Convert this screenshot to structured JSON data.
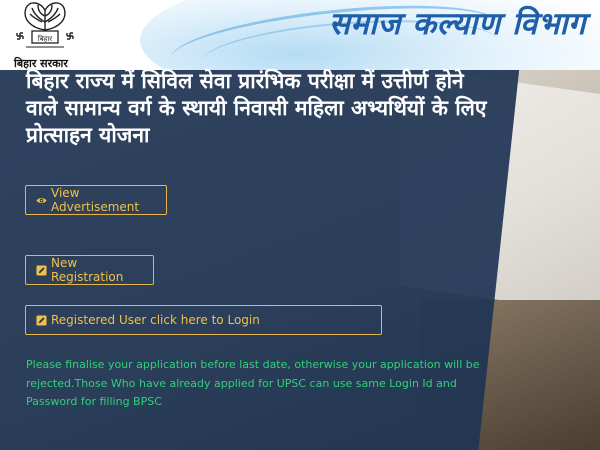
{
  "header": {
    "logo_caption": "बिहार सरकार",
    "department_title": "समाज कल्याण विभाग"
  },
  "main": {
    "scheme_title": "बिहार राज्य में सिविल सेवा प्रारंभिक परीक्षा में उत्तीर्ण होने वाले सामान्य वर्ग के स्थायी निवासी महिला अभ्यर्थियों के लिए प्रोत्साहन योजना",
    "buttons": {
      "view_advertisement": "View Advertisement",
      "new_registration": "New Registration",
      "registered_login": "Registered User click here to Login"
    },
    "notice": "Please finalise your application before last date, otherwise your application will be rejected.Those Who have already applied for UPSC can use same Login Id and Password for filling BPSC"
  },
  "colors": {
    "accent": "#f2c048",
    "title_blue": "#1f5ea8",
    "panel": "#1e3454",
    "notice_green": "#2fd17a"
  },
  "icons": {
    "view": "eye-icon",
    "register": "edit-icon",
    "login": "edit-icon"
  }
}
